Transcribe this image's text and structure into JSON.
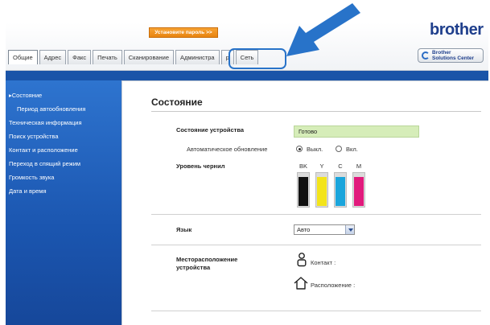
{
  "header": {
    "password_banner": "Установите пароль >>",
    "brand": "brother",
    "solutions_center": [
      "Brother",
      "Solutions Center"
    ]
  },
  "tabs": [
    {
      "label": "Общие",
      "active": true
    },
    {
      "label": "Адрес",
      "active": false
    },
    {
      "label": "Факс",
      "active": false
    },
    {
      "label": "Печать",
      "active": false
    },
    {
      "label": "Сканирование",
      "active": false
    },
    {
      "label": "Администра",
      "active": false
    },
    {
      "label": "р",
      "active": false
    },
    {
      "label": "Сеть",
      "active": false
    }
  ],
  "sidebar": {
    "items": [
      {
        "label": "▸Состояние",
        "sub": false
      },
      {
        "label": "Период автообновления",
        "sub": true
      },
      {
        "label": "Техническая информация",
        "sub": false
      },
      {
        "label": "Поиск устройства",
        "sub": false
      },
      {
        "label": "Контакт и расположение",
        "sub": false
      },
      {
        "label": "Переход в спящий режим",
        "sub": false
      },
      {
        "label": "Громкость звука",
        "sub": false
      },
      {
        "label": "Дата и время",
        "sub": false
      }
    ]
  },
  "main": {
    "title": "Состояние",
    "device_status_label": "Состояние устройства",
    "device_status_value": "Готово",
    "auto_refresh_label": "Автоматическое обновление",
    "auto_refresh_off": "Выкл.",
    "auto_refresh_on": "Вкл.",
    "auto_refresh_selected": "off",
    "ink_level_label": "Уровень чернил",
    "inks": [
      {
        "name": "BK",
        "color": "#111111",
        "level": 0.85
      },
      {
        "name": "Y",
        "color": "#f3e41a",
        "level": 0.85
      },
      {
        "name": "C",
        "color": "#1aa5dc",
        "level": 0.85
      },
      {
        "name": "M",
        "color": "#e11a7c",
        "level": 0.85
      }
    ],
    "language_label": "Язык",
    "language_value": "Авто",
    "location_label": "Месторасположение устройства",
    "contact_label": "Контакт :",
    "place_label": "Расположение :"
  },
  "colors": {
    "sidebar": "#1b56b0",
    "callout": "#2873c9",
    "status_ready": "#d6edb9"
  }
}
